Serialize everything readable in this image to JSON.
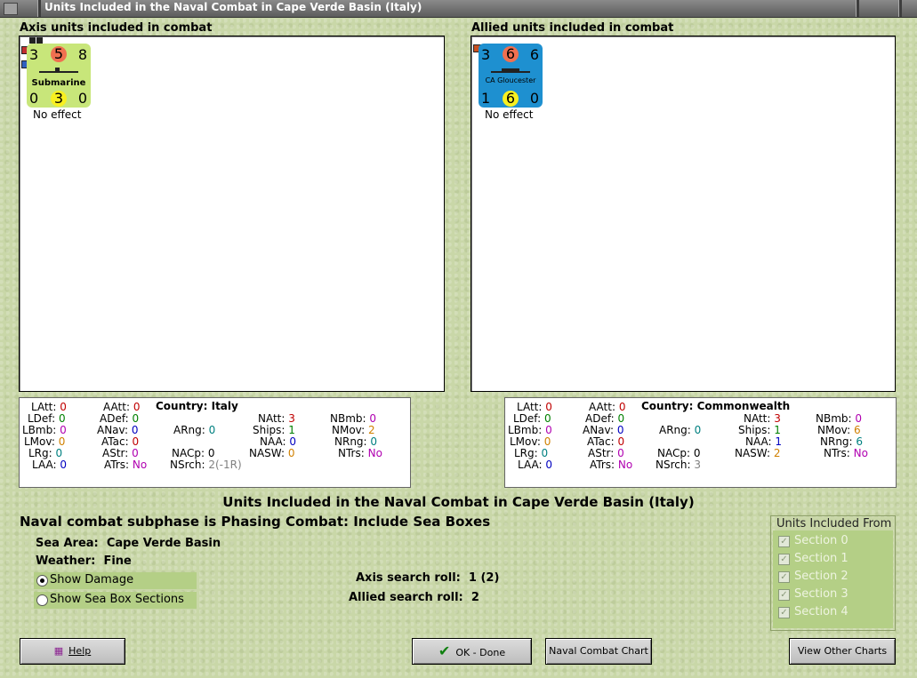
{
  "window": {
    "title": "Units Included in the Naval Combat in Cape Verde Basin (Italy)"
  },
  "axis": {
    "panel_label": "Axis units included in combat",
    "unit": {
      "top_left": "3",
      "top_mid": "5",
      "top_right": "8",
      "name": "Submarine",
      "bottom_left": "0",
      "bottom_mid": "3",
      "bottom_right": "0",
      "effect": "No effect",
      "color": "#c8e67a"
    },
    "stats": {
      "LAtt": "0",
      "LDef": "0",
      "LBmb": "0",
      "LMov": "0",
      "LRg": "0",
      "LAA": "0",
      "AAtt": "0",
      "ADef": "0",
      "ANav": "0",
      "ATac": "0",
      "AStr": "0",
      "ATrs": "No",
      "country_label": "Country:",
      "country": "Italy",
      "ARng": "0",
      "NACp": "0",
      "NSrch": "2",
      "NSrch_mod": "(-1R)",
      "NAtt": "3",
      "Ships": "1",
      "NAA": "0",
      "NASW": "0",
      "NBmb": "0",
      "NMov": "2",
      "NRng": "0",
      "NTrs": "No"
    }
  },
  "allied": {
    "panel_label": "Allied units included in combat",
    "unit": {
      "top_left": "3",
      "top_mid": "6",
      "top_right": "6",
      "name": "CA Gloucester",
      "bottom_left": "1",
      "bottom_mid": "6",
      "bottom_right": "0",
      "effect": "No effect",
      "color": "#1e90d0"
    },
    "stats": {
      "LAtt": "0",
      "LDef": "0",
      "LBmb": "0",
      "LMov": "0",
      "LRg": "0",
      "LAA": "0",
      "AAtt": "0",
      "ADef": "0",
      "ANav": "0",
      "ATac": "0",
      "AStr": "0",
      "ATrs": "No",
      "country_label": "Country:",
      "country": "Commonwealth",
      "ARng": "0",
      "NACp": "0",
      "NSrch": "3",
      "NAtt": "3",
      "Ships": "1",
      "NAA": "1",
      "NASW": "2",
      "NBmb": "0",
      "NMov": "6",
      "NRng": "6",
      "NTrs": "No"
    }
  },
  "main": {
    "heading": "Units Included in the Naval Combat in Cape Verde Basin (Italy)",
    "subphase": "Naval combat subphase is Phasing Combat: Include Sea Boxes",
    "sea_area_label": "Sea Area:",
    "sea_area": "Cape Verde Basin",
    "weather_label": "Weather:",
    "weather": "Fine",
    "show_damage": "Show Damage",
    "show_sections": "Show Sea Box Sections",
    "axis_roll_label": "Axis search roll:",
    "axis_roll": "1 (2)",
    "allied_roll_label": "Allied search roll:",
    "allied_roll": "2"
  },
  "sections": {
    "title": "Units Included From",
    "items": [
      "Section 0",
      "Section 1",
      "Section 2",
      "Section 3",
      "Section 4"
    ]
  },
  "buttons": {
    "help": "Help",
    "ok": "OK - Done",
    "chart": "Naval Combat Chart",
    "other": "View Other Charts"
  }
}
